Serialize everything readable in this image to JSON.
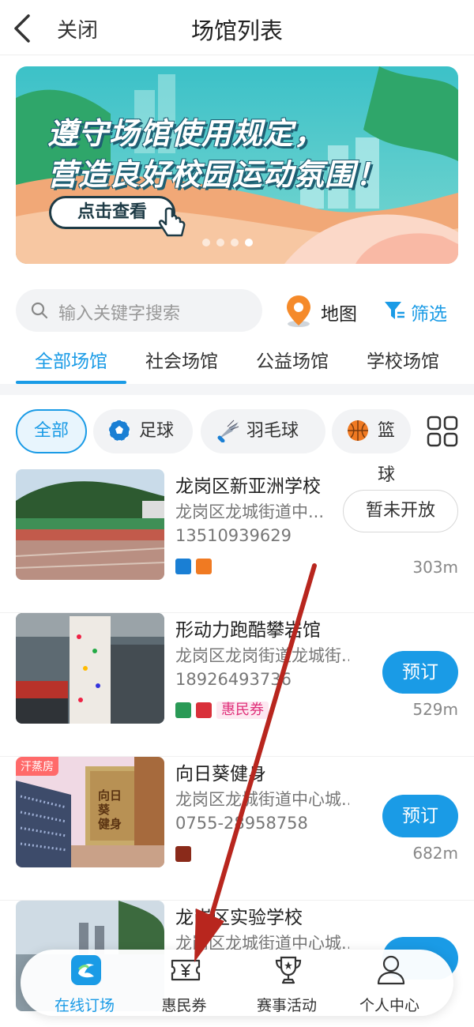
{
  "header": {
    "close_label": "关闭",
    "title": "场馆列表"
  },
  "banner": {
    "line1": "遵守场馆使用规定，",
    "line2": "营造良好校园运动氛围！",
    "button": "点击查看",
    "dots": 4,
    "active_dot": 3
  },
  "search": {
    "placeholder": "输入关键字搜索"
  },
  "map": {
    "label": "地图"
  },
  "filter": {
    "label": "筛选"
  },
  "tabs": [
    {
      "label": "全部场馆",
      "active": true
    },
    {
      "label": "社会场馆",
      "active": false
    },
    {
      "label": "公益场馆",
      "active": false
    },
    {
      "label": "学校场馆",
      "active": false
    }
  ],
  "chips": [
    {
      "label": "全部",
      "active": true
    },
    {
      "label": "足球",
      "icon": "soccer-icon"
    },
    {
      "label": "羽毛球",
      "icon": "badminton-icon"
    },
    {
      "label": "篮球",
      "icon": "basketball-icon"
    }
  ],
  "venues": [
    {
      "name": "龙岗区新亚洲学校",
      "address": "龙岗区龙城街道中...",
      "phone": "13510939629",
      "action": "暂未开放",
      "distance": "303m"
    },
    {
      "name": "形动力跑酷攀岩馆",
      "address": "龙岗区龙岗街道龙城街...",
      "phone": "18926493736",
      "coupon": "惠民券",
      "action": "预订",
      "distance": "529m"
    },
    {
      "name": "向日葵健身",
      "address": "龙岗区龙城街道中心城...",
      "phone": "0755-28958758",
      "action": "预订",
      "distance": "682m",
      "image_tag": "汗蒸房",
      "sign": "向日葵 健身"
    },
    {
      "name": "龙岗区实验学校",
      "address": "龙岗区龙城街道中心城..."
    }
  ],
  "bottom_nav": [
    {
      "label": "在线订场",
      "icon": "venue-booking-icon",
      "active": true
    },
    {
      "label": "惠民券",
      "icon": "coupon-icon"
    },
    {
      "label": "赛事活动",
      "icon": "trophy-icon"
    },
    {
      "label": "个人中心",
      "icon": "user-icon"
    }
  ],
  "colors": {
    "accent": "#1a9be6",
    "coupon": "#e0307a",
    "arrow": "#b8261e"
  }
}
